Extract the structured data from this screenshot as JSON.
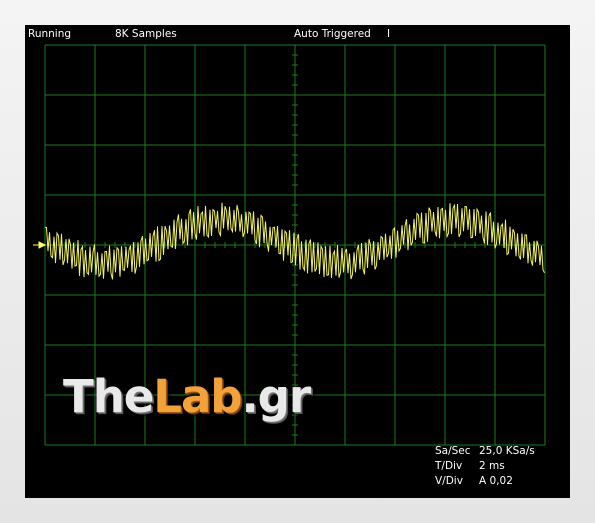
{
  "status": {
    "state": "Running",
    "samples": "8K Samples",
    "trigger": "Auto Triggered",
    "cursor": "I"
  },
  "watermark": {
    "part1": "The",
    "part2": "Lab",
    "part3": ".gr"
  },
  "readouts": [
    {
      "label": "Sa/Sec",
      "value": "25,0 KSa/s"
    },
    {
      "label": "T/Div",
      "value": "2 ms"
    },
    {
      "label": "V/Div",
      "value": "A 0,02"
    }
  ],
  "colors": {
    "background": "#000000",
    "grid": "#1d7a1d",
    "trace": "#ffff66",
    "text": "#ffffff",
    "brand_accent": "#f3a13a"
  },
  "trace_marker_icon": "arrow-right-icon"
}
